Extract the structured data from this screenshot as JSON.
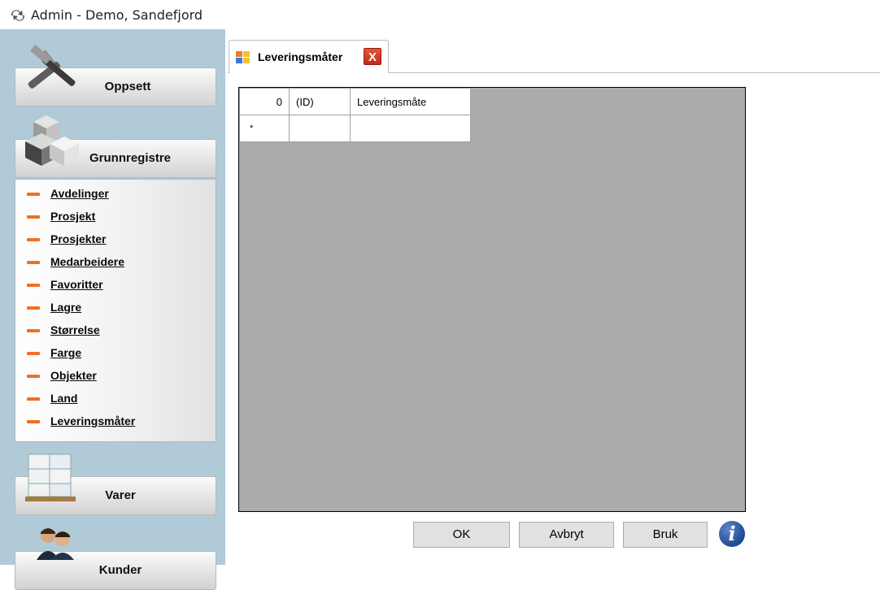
{
  "window": {
    "title": "Admin - Demo, Sandefjord",
    "app_icon": "gear-arrows-icon"
  },
  "sidebar": {
    "sections": [
      {
        "label": "Oppsett",
        "icon": "tools-icon"
      },
      {
        "label": "Grunnregistre",
        "icon": "cubes-icon"
      },
      {
        "label": "Varer",
        "icon": "pallet-boxes-icon"
      },
      {
        "label": "Kunder",
        "icon": "people-icon"
      }
    ],
    "items": [
      "Avdelinger",
      "Prosjekt",
      "Prosjekter",
      "Medarbeidere",
      "Favoritter",
      "Lagre",
      "Størrelse",
      "Farge",
      "Objekter",
      "Land",
      "Leveringsmåter"
    ]
  },
  "tab": {
    "label": "Leveringsmåter",
    "close": "X"
  },
  "grid": {
    "headers": [
      "0",
      "(ID)",
      "Leveringsmåte"
    ],
    "new_row_marker": "*"
  },
  "buttons": {
    "ok": "OK",
    "cancel": "Avbryt",
    "apply": "Bruk",
    "info": "i"
  },
  "colors": {
    "sidebar_bg": "#b0cad8",
    "grid_bg": "#ababab",
    "accent_dash": "#f07020"
  }
}
